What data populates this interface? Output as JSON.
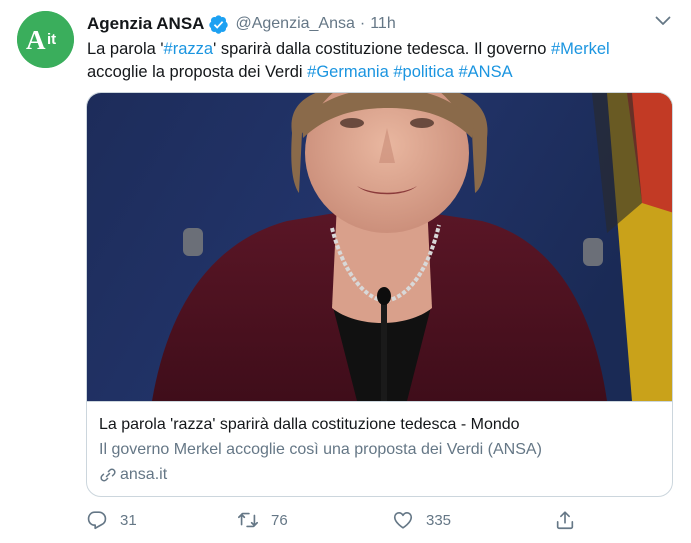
{
  "tweet": {
    "author": {
      "name": "Agenzia ANSA",
      "handle": "@Agenzia_Ansa",
      "separator": "·",
      "time": "11h",
      "avatar_text": "Ait",
      "avatar_color": "#3aae5c",
      "verified": true
    },
    "text": {
      "line1_a": "La parola '",
      "line1_tag1": "#razza",
      "line1_b": "' sparirà dalla costituzione tedesca. Il governo ",
      "line1_tag2": "#Merkel",
      "line2_a": "accoglie la proposta dei Verdi  ",
      "line2_tag1": "#Germania",
      "line2_tag2": "#politica",
      "line2_tag3": "#ANSA"
    },
    "card": {
      "title": "La parola 'razza' sparirà dalla costituzione tedesca - Mondo",
      "description": "Il governo Merkel accoglie così una proposta dei Verdi (ANSA)",
      "domain": "ansa.it"
    },
    "actions": {
      "replies": "31",
      "retweets": "76",
      "likes": "335"
    },
    "colors": {
      "link": "#1b95e0",
      "secondary_text": "#657786",
      "border": "#ccd6dd"
    },
    "icons": [
      "verified-badge-icon",
      "chevron-down-icon",
      "link-icon",
      "reply-icon",
      "retweet-icon",
      "like-icon",
      "share-icon"
    ]
  }
}
